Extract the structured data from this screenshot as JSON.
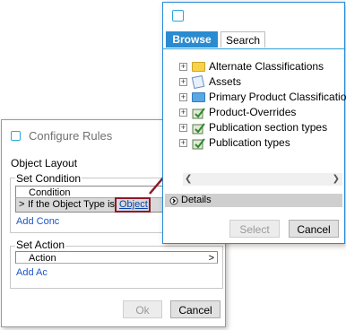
{
  "configure_rules": {
    "title": "Configure Rules",
    "section_label": "Object Layout",
    "set_condition": {
      "label": "Set Condition",
      "column_header": "Condition",
      "row_expand": ">",
      "row_text": "If the Object Type is",
      "row_link": "Object",
      "add_label": "Add Conc"
    },
    "set_action": {
      "label": "Set Action",
      "column_header": "Action",
      "column_arrow": ">",
      "add_label": "Add Ac"
    },
    "ok_label": "Ok",
    "cancel_label": "Cancel"
  },
  "browse_dialog": {
    "tabs": [
      "Browse",
      "Search"
    ],
    "tree": [
      {
        "label": "Alternate Classifications",
        "icon": "folder-yellow-icon"
      },
      {
        "label": "Assets",
        "icon": "asset-icon"
      },
      {
        "label": "Primary Product Classification",
        "icon": "folder-blue-icon"
      },
      {
        "label": "Product-Overrides",
        "icon": "product-icon"
      },
      {
        "label": "Publication section types",
        "icon": "product-icon"
      },
      {
        "label": "Publication types",
        "icon": "product-icon"
      }
    ],
    "details_label": "Details",
    "select_label": "Select",
    "cancel_label": "Cancel"
  },
  "colors": {
    "accent": "#2a8bd0",
    "highlight_box": "#8b1a2a",
    "link": "#0645ad"
  }
}
